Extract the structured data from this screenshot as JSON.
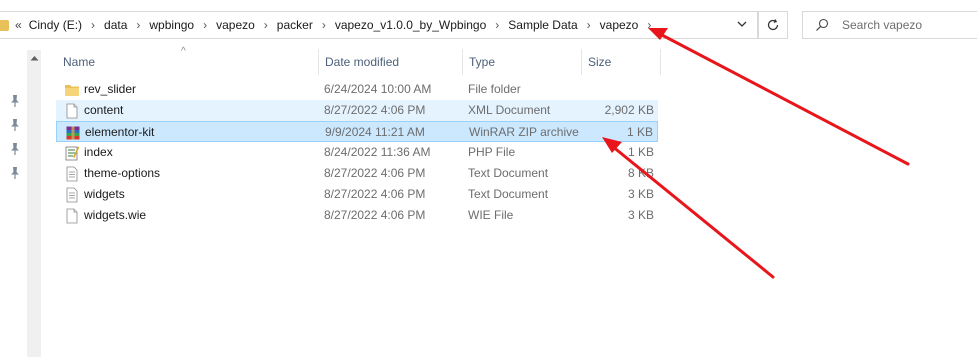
{
  "address_bar": {
    "overflow": "«",
    "crumbs": [
      "Cindy (E:)",
      "data",
      "wpbingo",
      "vapezo",
      "packer",
      "vapezo_v1.0.0_by_Wpbingo",
      "Sample Data",
      "vapezo"
    ]
  },
  "search": {
    "placeholder": "Search vapezo"
  },
  "columns": {
    "name": "Name",
    "date": "Date modified",
    "type": "Type",
    "size": "Size"
  },
  "files": [
    {
      "name": "rev_slider",
      "date": "6/24/2024 10:00 AM",
      "type": "File folder",
      "size": "",
      "icon": "folder-icon"
    },
    {
      "name": "content",
      "date": "8/27/2022 4:06 PM",
      "type": "XML Document",
      "size": "2,902 KB",
      "icon": "xml-file-icon"
    },
    {
      "name": "elementor-kit",
      "date": "9/9/2024 11:21 AM",
      "type": "WinRAR ZIP archive",
      "size": "1 KB",
      "icon": "winrar-icon"
    },
    {
      "name": "index",
      "date": "8/24/2022 11:36 AM",
      "type": "PHP File",
      "size": "1 KB",
      "icon": "php-file-icon"
    },
    {
      "name": "theme-options",
      "date": "8/27/2022 4:06 PM",
      "type": "Text Document",
      "size": "8 KB",
      "icon": "text-file-icon"
    },
    {
      "name": "widgets",
      "date": "8/27/2022 4:06 PM",
      "type": "Text Document",
      "size": "3 KB",
      "icon": "text-file-icon"
    },
    {
      "name": "widgets.wie",
      "date": "8/27/2022 4:06 PM",
      "type": "WIE File",
      "size": "3 KB",
      "icon": "generic-file-icon"
    }
  ],
  "colors": {
    "selection": "#cce8ff",
    "hover": "#e5f3ff",
    "annotation_arrow": "#e8161b",
    "folder": "#e9c15a"
  }
}
